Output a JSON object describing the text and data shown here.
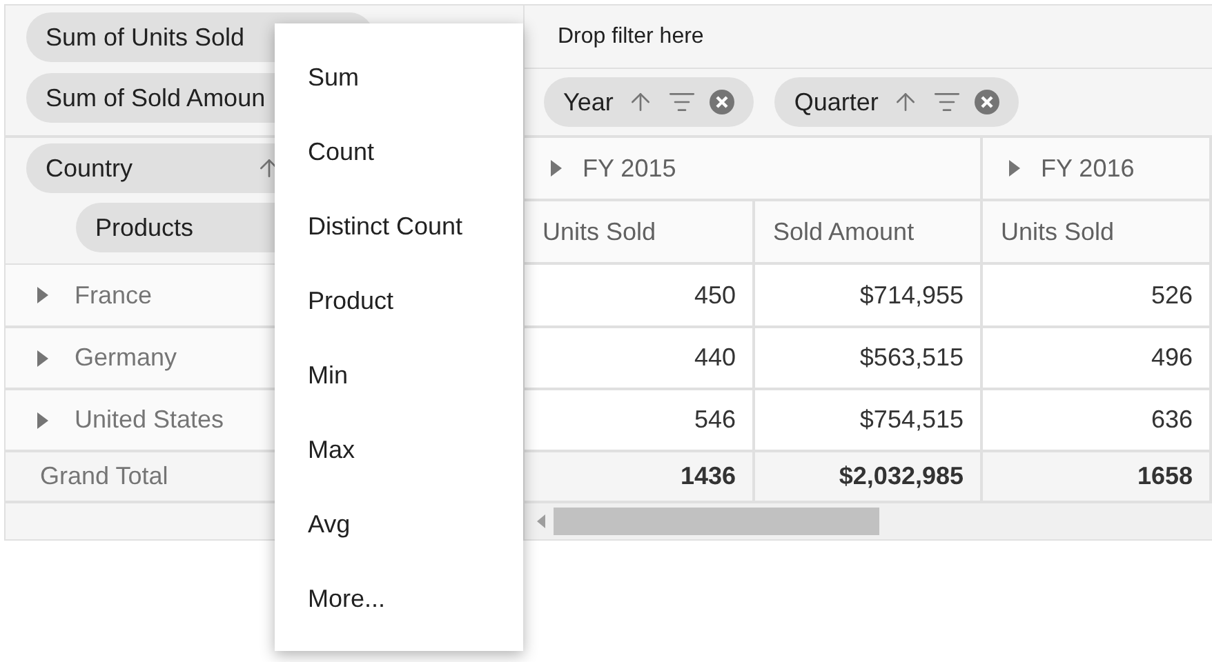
{
  "values_panel": {
    "chips": [
      {
        "label": "Sum of Units Sold"
      },
      {
        "label": "Sum of Sold Amoun"
      }
    ]
  },
  "filter_panel": {
    "hint": "Drop filter here"
  },
  "columns_panel": {
    "chips": [
      {
        "label": "Year"
      },
      {
        "label": "Quarter"
      }
    ]
  },
  "rows_panel": {
    "chips": [
      {
        "label": "Country"
      },
      {
        "label": "Products"
      }
    ]
  },
  "grid": {
    "column_groups": [
      {
        "label": "FY 2015",
        "expanded": false
      },
      {
        "label": "FY 2016",
        "expanded": false
      }
    ],
    "measures": [
      "Units Sold",
      "Sold Amount",
      "Units Sold"
    ],
    "rows": [
      {
        "label": "France",
        "expanded": false,
        "cells": [
          "450",
          "$714,955",
          "526"
        ]
      },
      {
        "label": "Germany",
        "expanded": false,
        "cells": [
          "440",
          "$563,515",
          "496"
        ]
      },
      {
        "label": "United States",
        "expanded": false,
        "cells": [
          "546",
          "$754,515",
          "636"
        ]
      }
    ],
    "grand_total": {
      "label": "Grand Total",
      "cells": [
        "1436",
        "$2,032,985",
        "1658"
      ]
    }
  },
  "aggregation_menu": {
    "items": [
      {
        "label": "Sum"
      },
      {
        "label": "Count"
      },
      {
        "label": "Distinct Count"
      },
      {
        "label": "Product"
      },
      {
        "label": "Min"
      },
      {
        "label": "Max"
      },
      {
        "label": "Avg"
      },
      {
        "label": "More..."
      }
    ]
  }
}
